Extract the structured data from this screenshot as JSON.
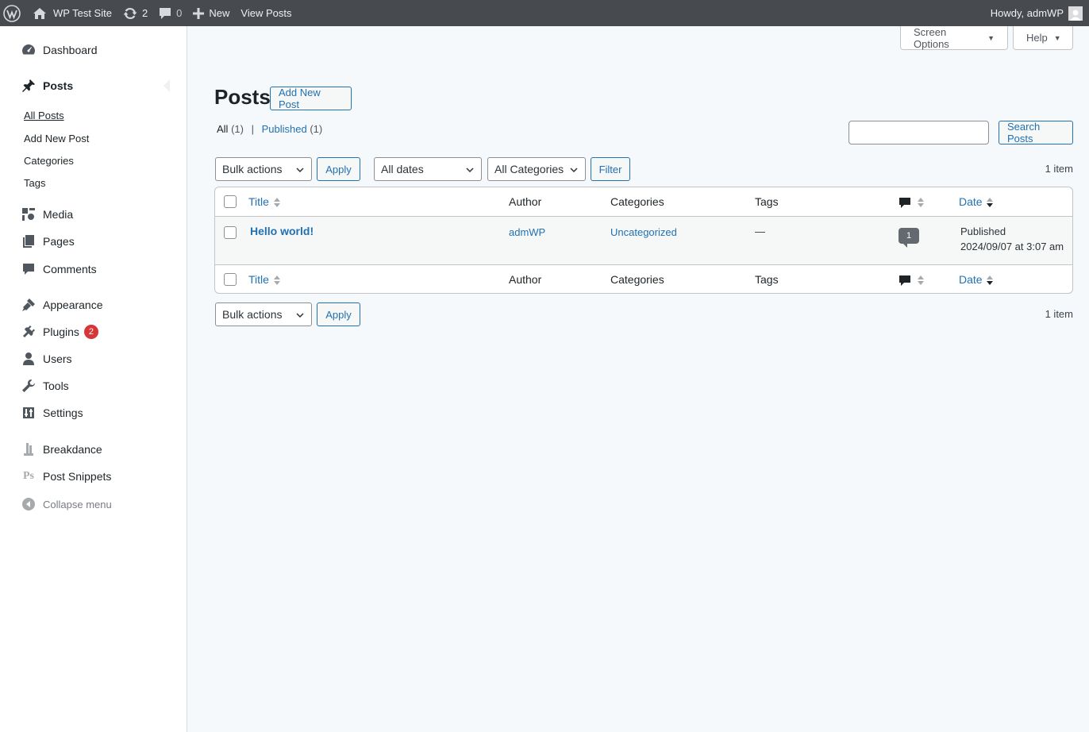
{
  "admin_bar": {
    "site_name": "WP Test Site",
    "updates_count": "2",
    "comments_count": "0",
    "new_label": "New",
    "view_posts": "View Posts",
    "howdy": "Howdy, admWP"
  },
  "sidebar": {
    "dashboard": "Dashboard",
    "posts": "Posts",
    "sub": {
      "all_posts": "All Posts",
      "add_new_post": "Add New Post",
      "categories": "Categories",
      "tags": "Tags"
    },
    "media": "Media",
    "pages": "Pages",
    "comments": "Comments",
    "appearance": "Appearance",
    "plugins": "Plugins",
    "plugins_badge": "2",
    "users": "Users",
    "tools": "Tools",
    "settings": "Settings",
    "breakdance": "Breakdance",
    "post_snippets_icon": "Ps",
    "post_snippets": "Post Snippets",
    "collapse": "Collapse menu"
  },
  "screen_options": "Screen Options",
  "help": "Help",
  "main": {
    "title": "Posts",
    "add_new": "Add New Post",
    "filters": {
      "all": "All",
      "all_count": "(1)",
      "sep": "|",
      "published": "Published",
      "published_count": "(1)"
    },
    "search_button": "Search Posts",
    "bulk_actions": "Bulk actions",
    "apply": "Apply",
    "all_dates": "All dates",
    "all_categories": "All Categories",
    "filter": "Filter",
    "items_count": "1 item"
  },
  "table": {
    "columns": {
      "title": "Title",
      "author": "Author",
      "categories": "Categories",
      "tags": "Tags",
      "date": "Date"
    },
    "rows": [
      {
        "title": "Hello world!",
        "author": "admWP",
        "categories": "Uncategorized",
        "tags": "—",
        "comments": "1",
        "status": "Published",
        "date": "2024/09/07 at 3:07 am"
      }
    ]
  }
}
